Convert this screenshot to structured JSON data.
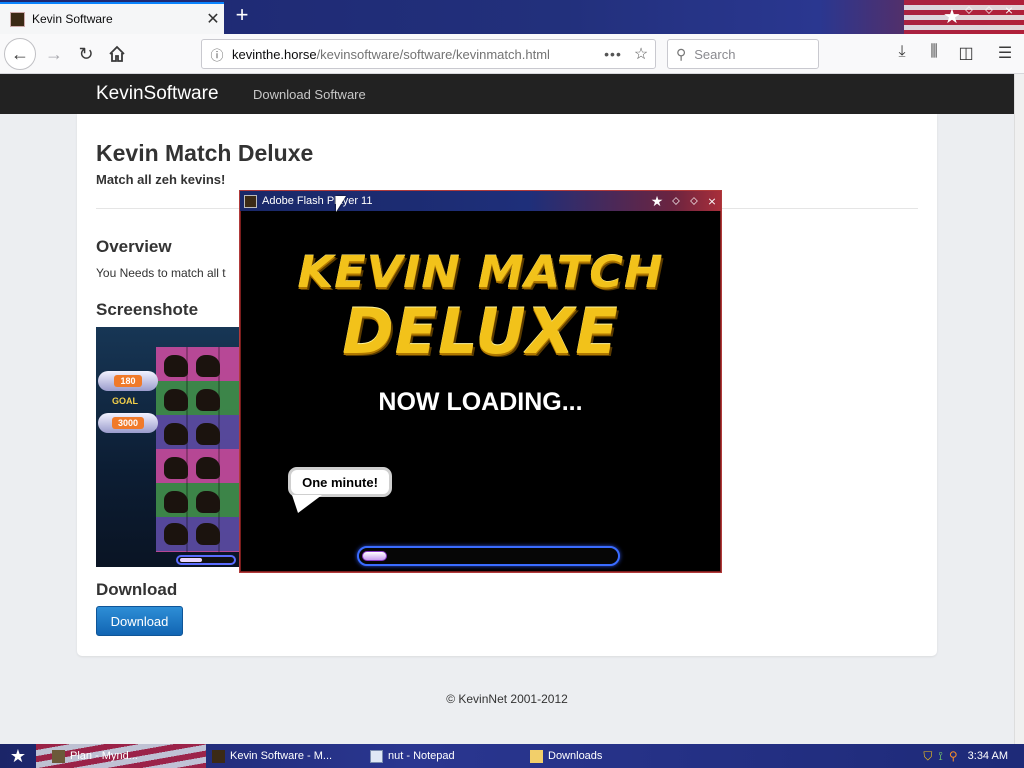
{
  "browser": {
    "tab": {
      "title": "Kevin Software",
      "close": "✕"
    },
    "new_tab": "+",
    "url_host": "kevinthe.horse",
    "url_path": "/kevinsoftware/software/kevinmatch.html",
    "search_placeholder": "Search"
  },
  "site": {
    "brand": "KevinSoftware",
    "nav_link": "Download Software",
    "title": "Kevin Match Deluxe",
    "subtitle": "Match all zeh kevins!",
    "overview_heading": "Overview",
    "overview_text": "You Needs to match all t",
    "screenshots_heading": "Screenshote",
    "screenshot": {
      "score": "180",
      "goal_label": "GOAL",
      "goal": "3000"
    },
    "download_heading": "Download",
    "download_button": "Download",
    "footer": "© KevinNet 2001-2012"
  },
  "flash_window": {
    "title": "Adobe Flash Player 11",
    "logo_line1": "KEVIN MATCH",
    "logo_line2": "DELUXE",
    "loading_text": "NOW LOADING...",
    "speech_bubble": "One minute!",
    "progress": 0.1
  },
  "taskbar": {
    "items": [
      {
        "label": "Plan - Mynd..."
      },
      {
        "label": "Kevin Software - M..."
      },
      {
        "label": "nut - Notepad"
      },
      {
        "label": "Downloads"
      }
    ],
    "clock": "3:34 AM"
  }
}
